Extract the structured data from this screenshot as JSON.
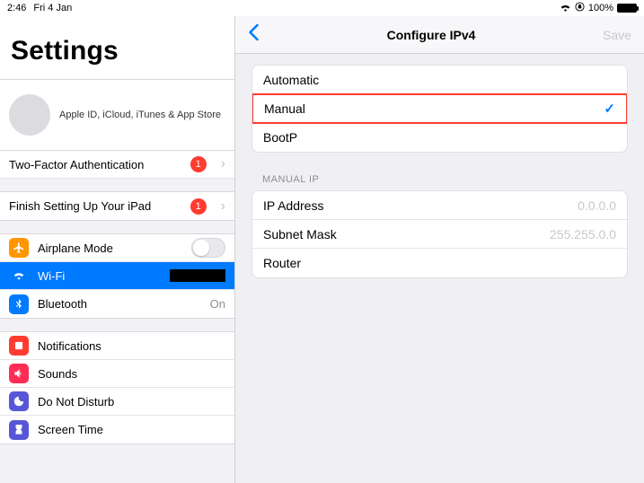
{
  "statusbar": {
    "time": "2:46",
    "date": "Fri 4 Jan",
    "battery_pct": "100%"
  },
  "sidebar": {
    "title": "Settings",
    "apple_id_sub": "Apple ID, iCloud, iTunes & App Store",
    "two_factor": {
      "label": "Two-Factor Authentication",
      "badge": "1"
    },
    "finish_setup": {
      "label": "Finish Setting Up Your iPad",
      "badge": "1"
    },
    "airplane": {
      "label": "Airplane Mode"
    },
    "wifi": {
      "label": "Wi-Fi",
      "value": "████████"
    },
    "bluetooth": {
      "label": "Bluetooth",
      "value": "On"
    },
    "notifications": {
      "label": "Notifications"
    },
    "sounds": {
      "label": "Sounds"
    },
    "dnd": {
      "label": "Do Not Disturb"
    },
    "screentime": {
      "label": "Screen Time"
    }
  },
  "detail": {
    "header": {
      "title": "Configure IPv4",
      "save": "Save"
    },
    "options": {
      "automatic": "Automatic",
      "manual": "Manual",
      "bootp": "BootP"
    },
    "manual_section_label": "MANUAL IP",
    "fields": {
      "ip": {
        "label": "IP Address",
        "placeholder": "0.0.0.0"
      },
      "subnet": {
        "label": "Subnet Mask",
        "placeholder": "255.255.0.0"
      },
      "router": {
        "label": "Router"
      }
    }
  }
}
